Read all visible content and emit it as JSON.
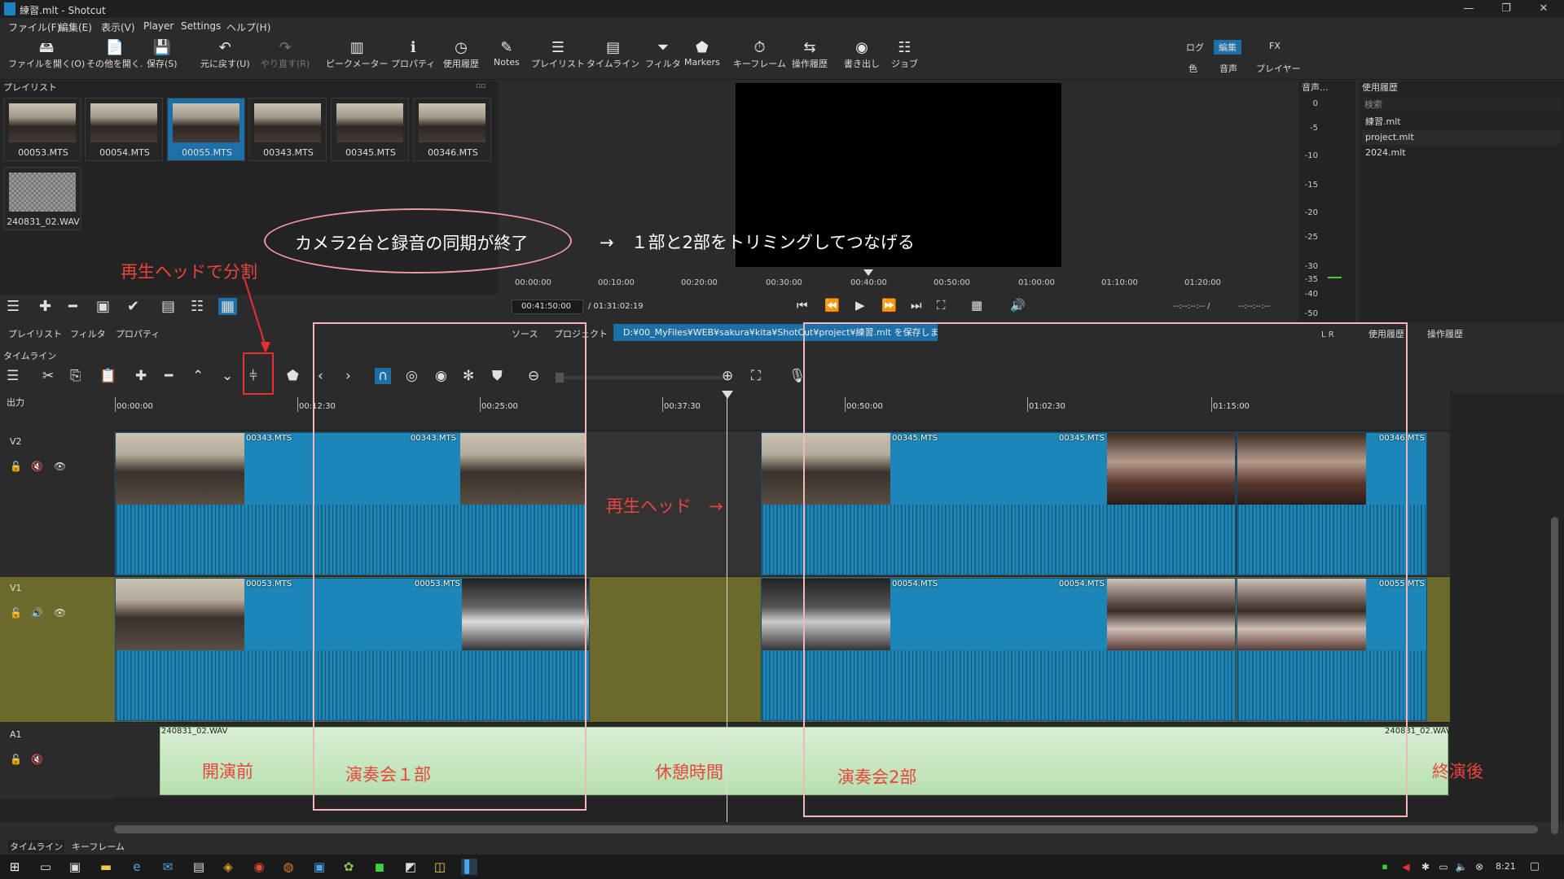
{
  "window": {
    "title": "練習.mlt - Shotcut",
    "minimize": "—",
    "maximize": "❐",
    "close": "✕"
  },
  "menu": [
    "ファイル(F)",
    "編集(E)",
    "表示(V)",
    "Player",
    "Settings",
    "ヘルプ(H)"
  ],
  "toolbar": [
    {
      "label": "ファイルを開く(O)",
      "icon": "open-icon",
      "glyph": "🖴",
      "enabled": true
    },
    {
      "label": "その他を開く.",
      "icon": "open-other-icon",
      "glyph": "📄",
      "enabled": true
    },
    {
      "label": "保存(S)",
      "icon": "save-icon",
      "glyph": "💾",
      "enabled": true
    },
    {
      "label": "元に戻す(U)",
      "icon": "undo-icon",
      "glyph": "↶",
      "enabled": true
    },
    {
      "label": "やり直す(R)",
      "icon": "redo-icon",
      "glyph": "↷",
      "enabled": false
    },
    {
      "label": "ピークメーター",
      "icon": "peak-meter-icon",
      "glyph": "▥",
      "enabled": true
    },
    {
      "label": "プロパティ",
      "icon": "properties-icon",
      "glyph": "ℹ",
      "enabled": true
    },
    {
      "label": "使用履歴",
      "icon": "history-icon",
      "glyph": "◷",
      "enabled": true
    },
    {
      "label": "Notes",
      "icon": "notes-icon",
      "glyph": "✎",
      "enabled": true
    },
    {
      "label": "プレイリスト",
      "icon": "playlist-icon",
      "glyph": "☰",
      "enabled": true
    },
    {
      "label": "タイムライン",
      "icon": "timeline-icon",
      "glyph": "▤",
      "enabled": true
    },
    {
      "label": "フィルタ",
      "icon": "filter-icon",
      "glyph": "⏷",
      "enabled": true
    },
    {
      "label": "Markers",
      "icon": "markers-icon",
      "glyph": "⬟",
      "enabled": true
    },
    {
      "label": "キーフレーム",
      "icon": "keyframes-icon",
      "glyph": "⏱",
      "enabled": true
    },
    {
      "label": "操作履歴",
      "icon": "undo-history-icon",
      "glyph": "⇆",
      "enabled": true
    },
    {
      "label": "書き出し",
      "icon": "export-icon",
      "glyph": "◉",
      "enabled": true
    },
    {
      "label": "ジョブ",
      "icon": "jobs-icon",
      "glyph": "☷",
      "enabled": true
    }
  ],
  "workspaces": {
    "row1": [
      "ログ",
      "編集",
      "FX"
    ],
    "row2": [
      "色",
      "音声",
      "プレイヤー"
    ],
    "active": "編集"
  },
  "playlist": {
    "title": "プレイリスト",
    "items": [
      "00053.MTS",
      "00054.MTS",
      "00055.MTS",
      "00343.MTS",
      "00345.MTS",
      "00346.MTS",
      "240831_02.WAV"
    ],
    "selected": "00055.MTS",
    "tabs": [
      "プレイリスト",
      "フィルタ",
      "プロパティ"
    ]
  },
  "player": {
    "ruler_labels": [
      "00:00:00",
      "00:10:00",
      "00:20:00",
      "00:30:00",
      "00:40:00",
      "00:50:00",
      "01:00:00",
      "01:10:00",
      "01:20:00"
    ],
    "current_time": "00:41:50:00",
    "total_time": "/ 01:31:02:19",
    "in_out": "--:--:--:-- /",
    "in_out2": "--:--:--:--",
    "tabs": [
      "ソース",
      "プロジェクト"
    ],
    "status": "D:¥00_MyFiles¥WEB¥sakura¥kita¥ShotCut¥project¥練習.mlt を保存しました"
  },
  "audio_meter": {
    "title": "音声...",
    "labels": [
      "0",
      "-5",
      "-10",
      "-15",
      "-20",
      "-25",
      "-30",
      "-35",
      "-40",
      "-50"
    ],
    "channels": "L  R"
  },
  "recent": {
    "title": "使用履歴",
    "search_placeholder": "検索",
    "items": [
      "練習.mlt",
      "project.mlt",
      "2024.mlt"
    ],
    "tabs": [
      "使用履歴",
      "操作履歴"
    ]
  },
  "timeline": {
    "title": "タイムライン",
    "output_label": "出力",
    "ruler": [
      "00:00:00",
      "00:12:30",
      "00:25:00",
      "00:37:30",
      "00:50:00",
      "01:02:30",
      "01:15:00"
    ],
    "tracks": {
      "v2": "V2",
      "v1": "V1",
      "a1": "A1"
    },
    "v2_clips": [
      "00343.MTS",
      "00343.MTS",
      "00345.MTS",
      "00345.MTS",
      "00346.MTS"
    ],
    "v1_clips": [
      "00053.MTS",
      "00053.MTS",
      "00054.MTS",
      "00054.MTS",
      "00055.MTS"
    ],
    "a1_clip": "240831_02.WAV",
    "a1_clip_end": "240831_02.WAV",
    "bottom_tabs": [
      "タイムライン",
      "キーフレーム"
    ]
  },
  "annotations": {
    "sync_done": "カメラ2台と録音の同期が終了",
    "arrow_text": "→　１部と2部をトリミングしてつなげる",
    "split_label": "再生ヘッドで分割",
    "playhead_label": "再生ヘッド　→",
    "sections": [
      "開演前",
      "演奏会１部",
      "休憩時間",
      "演奏会2部",
      "終演後"
    ]
  },
  "taskbar": {
    "clock": "8:21"
  }
}
